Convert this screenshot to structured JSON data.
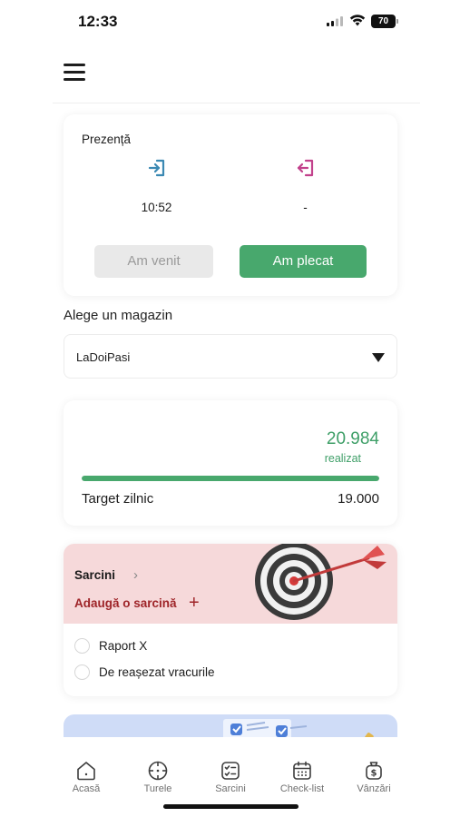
{
  "status_bar": {
    "time": "12:33",
    "battery": "70"
  },
  "menu": {
    "icon": "hamburger-icon"
  },
  "attendance": {
    "title": "Prezență",
    "checkin_icon": "checkin-icon",
    "checkout_icon": "checkout-icon",
    "checkin_time": "10:52",
    "checkout_time": "-",
    "arrived_button": "Am venit",
    "left_button": "Am plecat"
  },
  "store": {
    "label": "Alege un magazin",
    "selected": "LaDoiPasi"
  },
  "daily_target": {
    "amount": "20.984",
    "amount_caption": "realizat",
    "label": "Target zilnic",
    "target_value": "19.000",
    "progress_fraction": 1.0
  },
  "tasks": {
    "title": "Sarcini",
    "add_label": "Adaugă o sarcină",
    "items": [
      {
        "label": "Raport X",
        "done": false
      },
      {
        "label": "De reașezat vracurile",
        "done": false
      }
    ]
  },
  "nav": [
    {
      "label": "Acasă",
      "icon": "home-icon"
    },
    {
      "label": "Turele",
      "icon": "crosshair-icon"
    },
    {
      "label": "Sarcini",
      "icon": "checklist-icon"
    },
    {
      "label": "Check-list",
      "icon": "calendar-icon"
    },
    {
      "label": "Vânzări",
      "icon": "money-bag-icon"
    }
  ],
  "colors": {
    "accent_green": "#48a86d",
    "task_header": "#f6d9da",
    "task_red": "#9e2428"
  }
}
